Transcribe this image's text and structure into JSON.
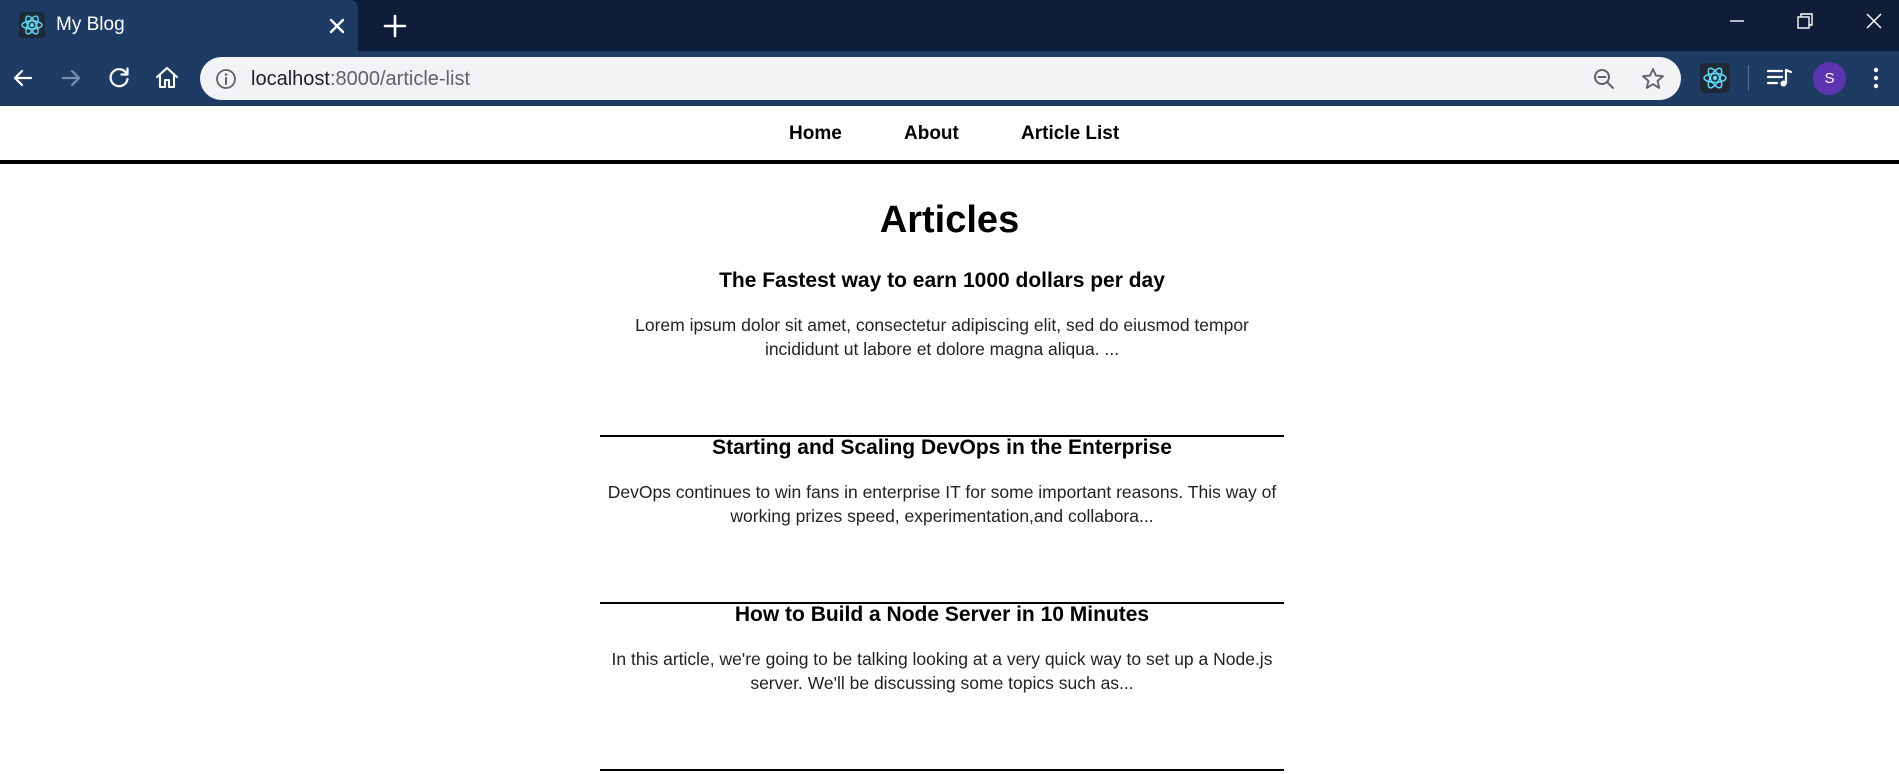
{
  "browser": {
    "tab": {
      "title": "My Blog",
      "favicon": "react-icon"
    },
    "address_bar": {
      "host": "localhost",
      "path": ":8000/article-list"
    },
    "profile": {
      "initial": "S",
      "color": "#5e35b1"
    },
    "colors": {
      "tabstrip": "#0f1d38",
      "toolbar": "#1d3b63",
      "omnibox": "#f1f3f4",
      "react_accent": "#61dafb"
    }
  },
  "nav": {
    "items": [
      {
        "label": "Home"
      },
      {
        "label": "About"
      },
      {
        "label": "Article List"
      }
    ]
  },
  "page": {
    "heading": "Articles",
    "articles": [
      {
        "title": "The Fastest way to earn 1000 dollars per day",
        "excerpt": "Lorem ipsum dolor sit amet, consectetur adipiscing elit, sed do eiusmod tempor incididunt ut labore et dolore magna aliqua. ..."
      },
      {
        "title": "Starting and Scaling DevOps in the Enterprise",
        "excerpt": "DevOps continues to win fans in enterprise IT for some important reasons. This way of working prizes speed, experimentation,and collabora..."
      },
      {
        "title": "How to Build a Node Server in 10 Minutes",
        "excerpt": "In this article, we're going to be talking looking at a very quick way to set up a Node.js server. We'll be discussing some topics such as..."
      }
    ]
  }
}
